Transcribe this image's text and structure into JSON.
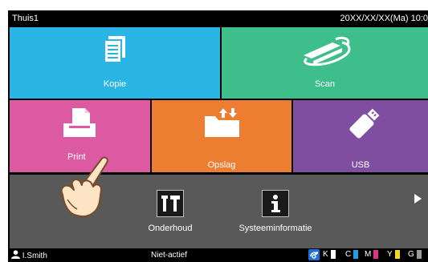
{
  "header": {
    "title": "Thuis1",
    "datetime": "20XX/XX/XX(Ma) 10:0"
  },
  "tiles": {
    "kopie": {
      "label": "Kopie",
      "color": "#29b6e6"
    },
    "scan": {
      "label": "Scan",
      "color": "#3dbe8a"
    },
    "print": {
      "label": "Print",
      "color": "#db5aa2"
    },
    "opslag": {
      "label": "Opslag",
      "color": "#ed7d31"
    },
    "usb": {
      "label": "USB",
      "color": "#7f4ea1"
    }
  },
  "tray": {
    "items": [
      {
        "label": "Onderhoud",
        "icon": "tools-icon"
      },
      {
        "label": "Systeeminformatie",
        "icon": "info-icon"
      }
    ]
  },
  "status": {
    "user": "I.Smith",
    "state": "Niet-actief",
    "inks": [
      {
        "letter": "K",
        "color": "#000000",
        "level": 0.0
      },
      {
        "letter": "C",
        "color": "#1ea0e8",
        "level": 1.0
      },
      {
        "letter": "M",
        "color": "#e0308a",
        "level": 1.0
      },
      {
        "letter": "Y",
        "color": "#f4d81c",
        "level": 1.0
      },
      {
        "letter": "G",
        "color": "#9a9a9a",
        "level": 1.0
      }
    ]
  }
}
